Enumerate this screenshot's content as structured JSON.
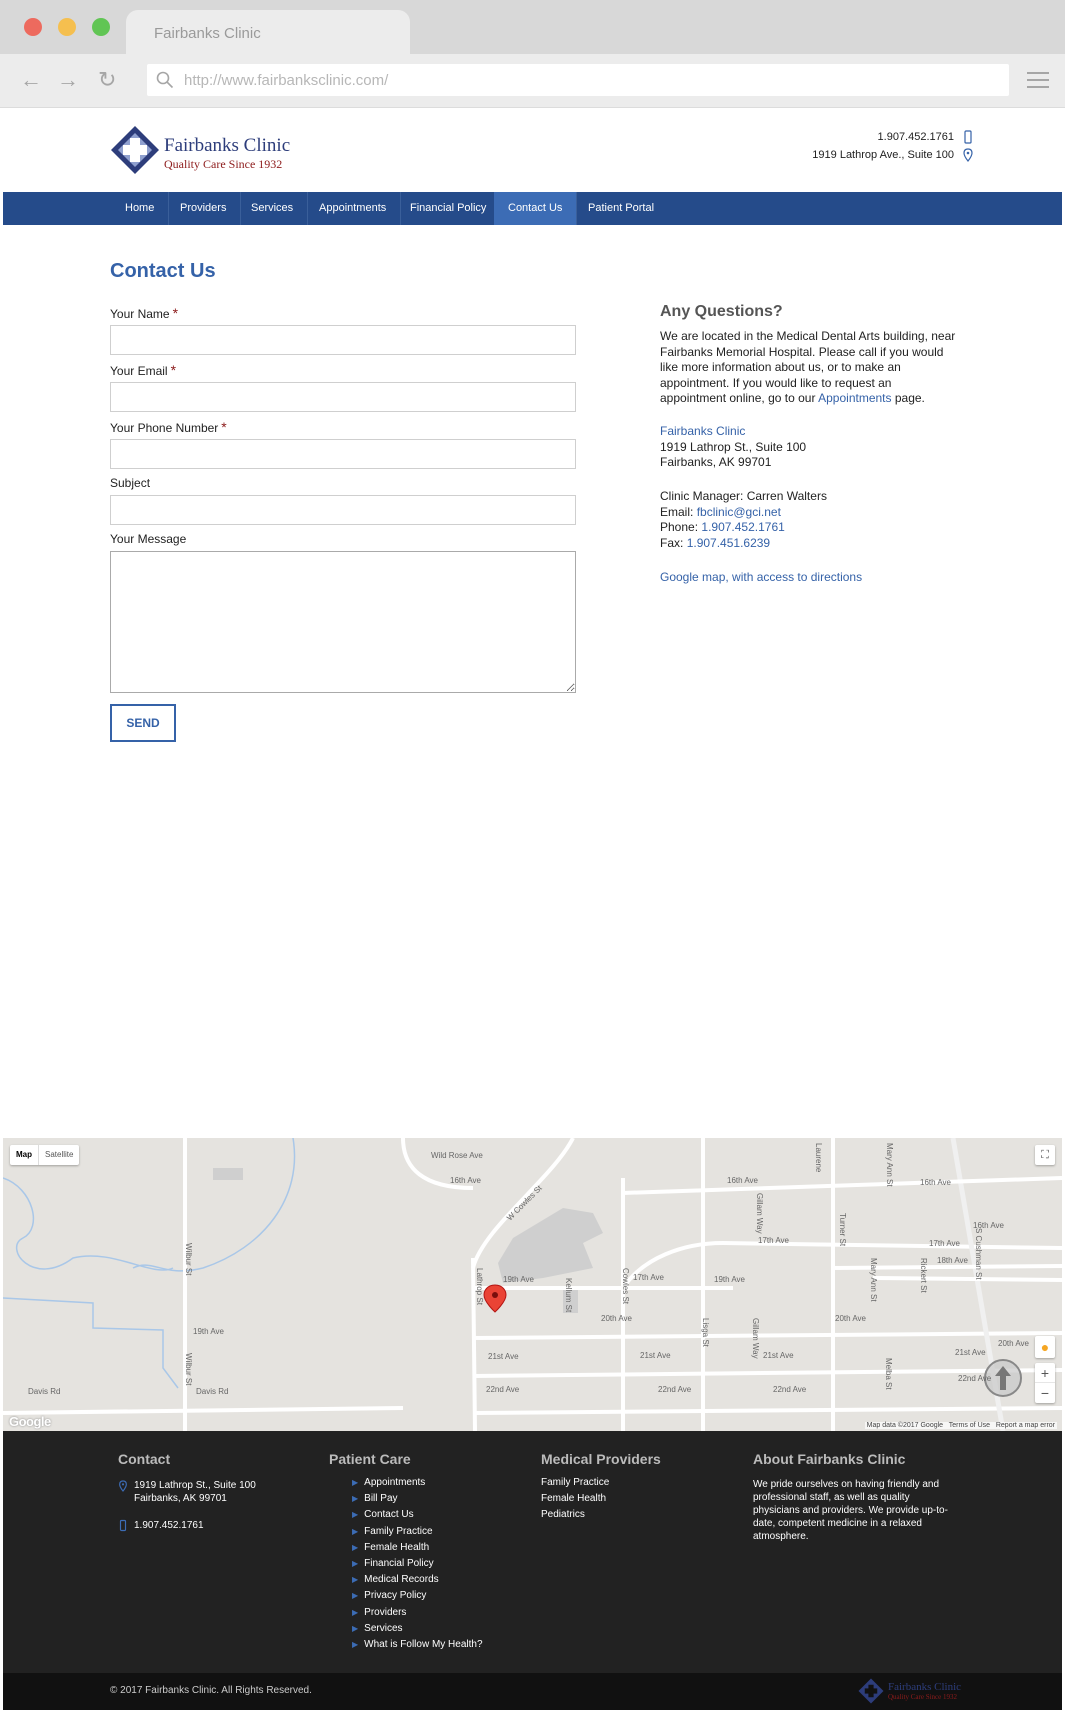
{
  "browser": {
    "tab_title": "Fairbanks Clinic",
    "url": "http://www.fairbanksclinic.com/"
  },
  "header": {
    "logo_name": "Fairbanks Clinic",
    "logo_tagline": "Quality Care Since 1932",
    "phone": "1.907.452.1761",
    "address": "1919 Lathrop Ave., Suite 100"
  },
  "nav": {
    "items": [
      {
        "label": "Home"
      },
      {
        "label": "Providers"
      },
      {
        "label": "Services"
      },
      {
        "label": "Appointments"
      },
      {
        "label": "Financial Policy"
      },
      {
        "label": "Contact Us",
        "active": true
      },
      {
        "label": "Patient Portal"
      }
    ]
  },
  "main": {
    "title": "Contact Us",
    "form": {
      "name_label": "Your Name",
      "email_label": "Your Email",
      "phone_label": "Your Phone Number",
      "subject_label": "Subject",
      "message_label": "Your Message",
      "required_mark": "*",
      "send_label": "SEND"
    }
  },
  "aside": {
    "title": "Any Questions?",
    "intro": "We are located in the Medical Dental Arts building, near Fairbanks Memorial Hospital. Please call if you would like more information about us, or to make an appointment. If you would like to request an appointment online, go to our",
    "intro_link": "Appointments",
    "intro_end": "page.",
    "clinic_name": "Fairbanks Clinic",
    "street": "1919 Lathrop St., Suite 100",
    "city": "Fairbanks, AK 99701",
    "manager": "Clinic Manager: Carren Walters",
    "email_label": "Email:",
    "email": "fbclinic@gci.net",
    "phone_label": "Phone:",
    "phone": "1.907.452.1761",
    "fax_label": "Fax:",
    "fax": "1.907.451.6239",
    "map_link": "Google map, with access to directions"
  },
  "map": {
    "type_map": "Map",
    "type_satellite": "Satellite",
    "zoom_in": "+",
    "zoom_out": "−",
    "attribution": "Map data ©2017 Google",
    "terms": "Terms of Use",
    "report": "Report a map error",
    "google": "Google",
    "streets": {
      "wild_rose": "Wild Rose Ave",
      "sixteenth_left": "16th Ave",
      "sixteenth_mid": "16th Ave",
      "sixteenth_right": "16th Ave",
      "sixteenth_far": "16th Ave",
      "seventeenth": "17th Ave",
      "seventeenth_right": "17th Ave",
      "seventeenth_far": "17th Ave",
      "eighteenth": "18th Ave",
      "nineteenth": "19th Ave",
      "nineteenth_mid": "19th Ave",
      "nineteenth_left": "19th Ave",
      "twentieth": "20th Ave",
      "twentieth_right": "20th Ave",
      "twentieth_far": "20th Ave",
      "twentyfirst_a": "21st Ave",
      "twentyfirst_b": "21st Ave",
      "twentyfirst_c": "21st Ave",
      "twentyfirst_d": "21st Ave",
      "twentysecond_a": "22nd Ave",
      "twentysecond_b": "22nd Ave",
      "twentysecond_c": "22nd Ave",
      "twentysecond_d": "22nd Ave",
      "davis": "Davis Rd",
      "davis_b": "Davis Rd",
      "cowles": "Cowles St",
      "w_cowles": "W Cowles St",
      "lathrop": "Lathrop St",
      "wilbur": "Wilbur St",
      "wilbur_b": "Wilbur St",
      "gillam": "Gillam Way",
      "gillam_b": "Gillam Way",
      "turner": "Turner St",
      "mary_ann": "Mary Ann St",
      "mary_ann_b": "Mary Ann St",
      "rickert": "Rickert St",
      "cushman": "S Cushman St",
      "kellum": "Kellum St",
      "laurene": "Laurene",
      "lisga": "Lisga St",
      "melba": "Melba St"
    }
  },
  "footer": {
    "contact_title": "Contact",
    "contact_street": "1919 Lathrop St., Suite 100",
    "contact_city": "Fairbanks, AK 99701",
    "contact_phone": "1.907.452.1761",
    "patient_care_title": "Patient Care",
    "patient_care": [
      "Appointments",
      "Bill Pay",
      "Contact Us",
      "Family Practice",
      "Female Health",
      "Financial Policy",
      "Medical Records",
      "Privacy Policy",
      "Providers",
      "Services",
      "What is Follow My Health?"
    ],
    "providers_title": "Medical Providers",
    "providers": [
      "Family Practice",
      "Female Health",
      "Pediatrics"
    ],
    "about_title": "About Fairbanks Clinic",
    "about_text": "We pride ourselves on having friendly and professional staff, as well as quality physicians and providers. We provide up-to-date, competent medicine in a relaxed atmosphere.",
    "copyright": "© 2017 Fairbanks Clinic. All Rights Reserved.",
    "mini_logo_name": "Fairbanks Clinic",
    "mini_logo_tagline": "Quality Care Since 1932"
  },
  "colors": {
    "brand_blue": "#254b8a",
    "active_nav": "#3c6cb5",
    "link": "#3562a8",
    "required": "#8b1a1a",
    "footer_bg": "#222222"
  }
}
